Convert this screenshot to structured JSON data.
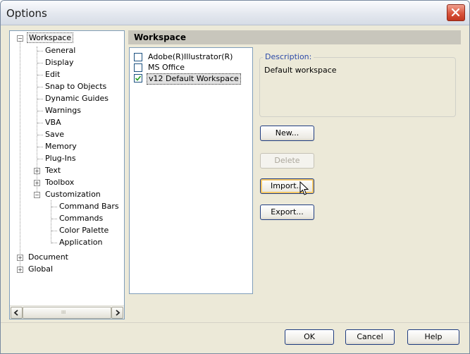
{
  "window": {
    "title": "Options"
  },
  "tree": {
    "items": [
      {
        "label": "Workspace",
        "expander": "−"
      },
      {
        "label": "General"
      },
      {
        "label": "Display"
      },
      {
        "label": "Edit"
      },
      {
        "label": "Snap to Objects"
      },
      {
        "label": "Dynamic Guides"
      },
      {
        "label": "Warnings"
      },
      {
        "label": "VBA"
      },
      {
        "label": "Save"
      },
      {
        "label": "Memory"
      },
      {
        "label": "Plug-Ins"
      },
      {
        "label": "Text",
        "expander": "+"
      },
      {
        "label": "Toolbox",
        "expander": "+"
      },
      {
        "label": "Customization",
        "expander": "−"
      },
      {
        "label": "Command Bars"
      },
      {
        "label": "Commands"
      },
      {
        "label": "Color Palette"
      },
      {
        "label": "Application"
      },
      {
        "label": "Document",
        "expander": "+"
      },
      {
        "label": "Global",
        "expander": "+"
      }
    ],
    "scroll_mid_glyph": "III",
    "selected": "Workspace"
  },
  "panel": {
    "header": "Workspace",
    "workspaces": [
      {
        "label": "Adobe(R)Illustrator(R)",
        "checked": false
      },
      {
        "label": "MS Office",
        "checked": false
      },
      {
        "label": "v12 Default Workspace",
        "checked": true
      }
    ],
    "description_label": "Description:",
    "description_text": "Default workspace"
  },
  "buttons": {
    "new": "New...",
    "delete": "Delete",
    "import": "Import...",
    "export": "Export...",
    "ok": "OK",
    "cancel": "Cancel",
    "help": "Help"
  },
  "icons": {
    "close": "close-icon",
    "checkmark": "checkmark-icon",
    "scroll_left": "arrow-left-icon",
    "scroll_right": "arrow-right-icon",
    "cursor": "pointer-cursor-icon"
  }
}
